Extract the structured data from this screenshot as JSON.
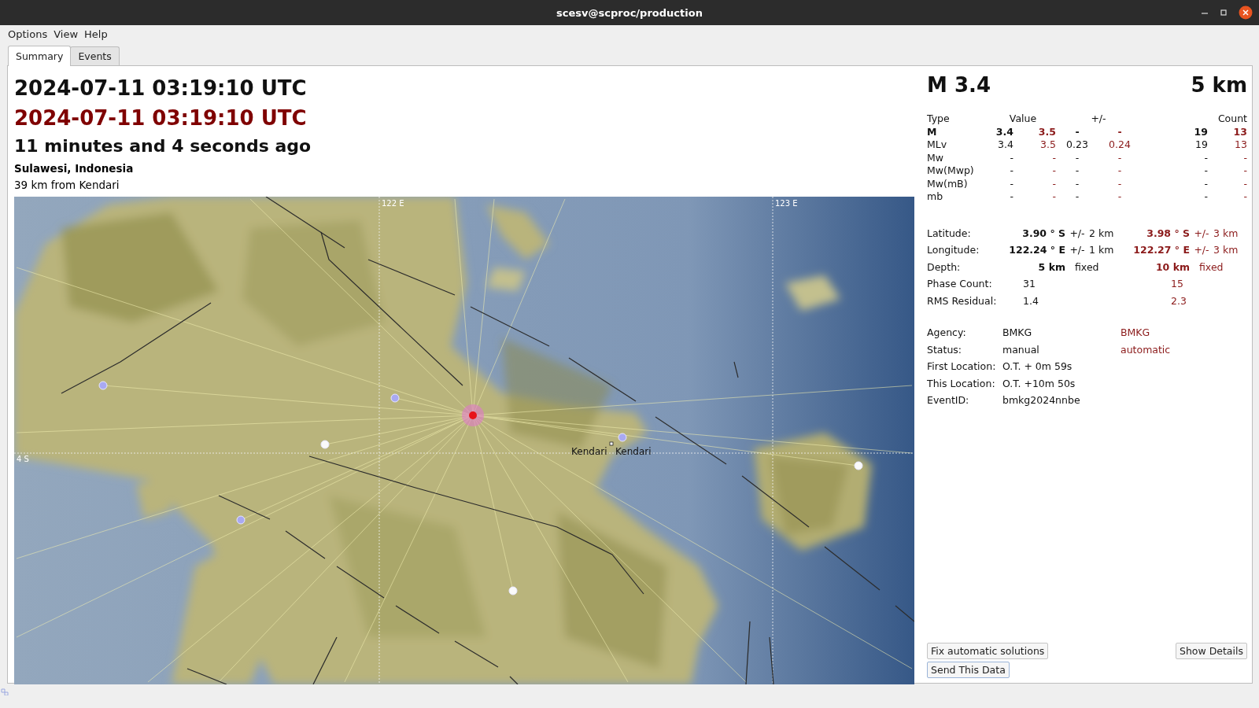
{
  "window": {
    "title": "scesv@scproc/production"
  },
  "menu": [
    "Options",
    "View",
    "Help"
  ],
  "tabs": [
    {
      "label": "Summary",
      "selected": true
    },
    {
      "label": "Events",
      "selected": false
    }
  ],
  "origin": {
    "time": "2024-07-11 03:19:10 UTC",
    "automatic_time": "2024-07-11 03:19:10 UTC",
    "ago": "11 minutes and 4 seconds ago",
    "region": "Sulawesi, Indonesia",
    "nearest": "39 km from Kendari"
  },
  "map": {
    "longitude_labels": [
      "122 E",
      "123 E"
    ],
    "latitude_labels": [
      "4 S"
    ],
    "city_labels": [
      "Kendari",
      "Kendari"
    ]
  },
  "magnitude": {
    "headline": "M 3.4",
    "depth_headline": "5 km",
    "columns": [
      "Type",
      "Value",
      "+/-",
      "Count"
    ],
    "rows": [
      {
        "type": "M",
        "preferred": true,
        "value": "3.4",
        "value_auto": "3.5",
        "error": "-",
        "error_auto": "-",
        "count": "19",
        "count_auto": "13"
      },
      {
        "type": "MLv",
        "preferred": false,
        "value": "3.4",
        "value_auto": "3.5",
        "error": "0.23",
        "error_auto": "0.24",
        "count": "19",
        "count_auto": "13"
      },
      {
        "type": "Mw",
        "preferred": false,
        "value": "-",
        "value_auto": "-",
        "error": "-",
        "error_auto": "-",
        "count": "-",
        "count_auto": "-"
      },
      {
        "type": "Mw(Mwp)",
        "preferred": false,
        "value": "-",
        "value_auto": "-",
        "error": "-",
        "error_auto": "-",
        "count": "-",
        "count_auto": "-"
      },
      {
        "type": "Mw(mB)",
        "preferred": false,
        "value": "-",
        "value_auto": "-",
        "error": "-",
        "error_auto": "-",
        "count": "-",
        "count_auto": "-"
      },
      {
        "type": "mb",
        "preferred": false,
        "value": "-",
        "value_auto": "-",
        "error": "-",
        "error_auto": "-",
        "count": "-",
        "count_auto": "-"
      }
    ]
  },
  "location": [
    {
      "label": "Latitude:",
      "kind": "coordinate",
      "manual": [
        "3.90 ° S",
        "+/-",
        "2 km"
      ],
      "automatic": [
        "3.98 ° S",
        "+/-",
        "3 km"
      ]
    },
    {
      "label": "Longitude:",
      "kind": "coordinate",
      "manual": [
        "122.24 ° E",
        "+/-",
        "1 km"
      ],
      "automatic": [
        "122.27 ° E",
        "+/-",
        "3 km"
      ]
    },
    {
      "label": "Depth:",
      "kind": "depth",
      "manual": [
        "5 km",
        "fixed"
      ],
      "automatic": [
        "10 km",
        "fixed"
      ]
    },
    {
      "label": "Phase Count:",
      "kind": "count",
      "manual": [
        "31"
      ],
      "automatic": [
        "15"
      ]
    },
    {
      "label": "RMS Residual:",
      "kind": "count",
      "manual": [
        "1.4"
      ],
      "automatic": [
        "2.3"
      ]
    }
  ],
  "info": [
    {
      "label": "Agency:",
      "manual": "BMKG",
      "automatic": "BMKG"
    },
    {
      "label": "Status:",
      "manual": "manual",
      "automatic": "automatic"
    },
    {
      "label": "First Location:",
      "manual": "O.T. + 0m 59s"
    },
    {
      "label": "This Location:",
      "manual": "O.T. +10m 50s"
    },
    {
      "label": "EventID:",
      "manual": "bmkg2024nnbe"
    }
  ],
  "buttons": {
    "fix": "Fix automatic solutions",
    "details": "Show Details",
    "send": "Send This Data"
  }
}
